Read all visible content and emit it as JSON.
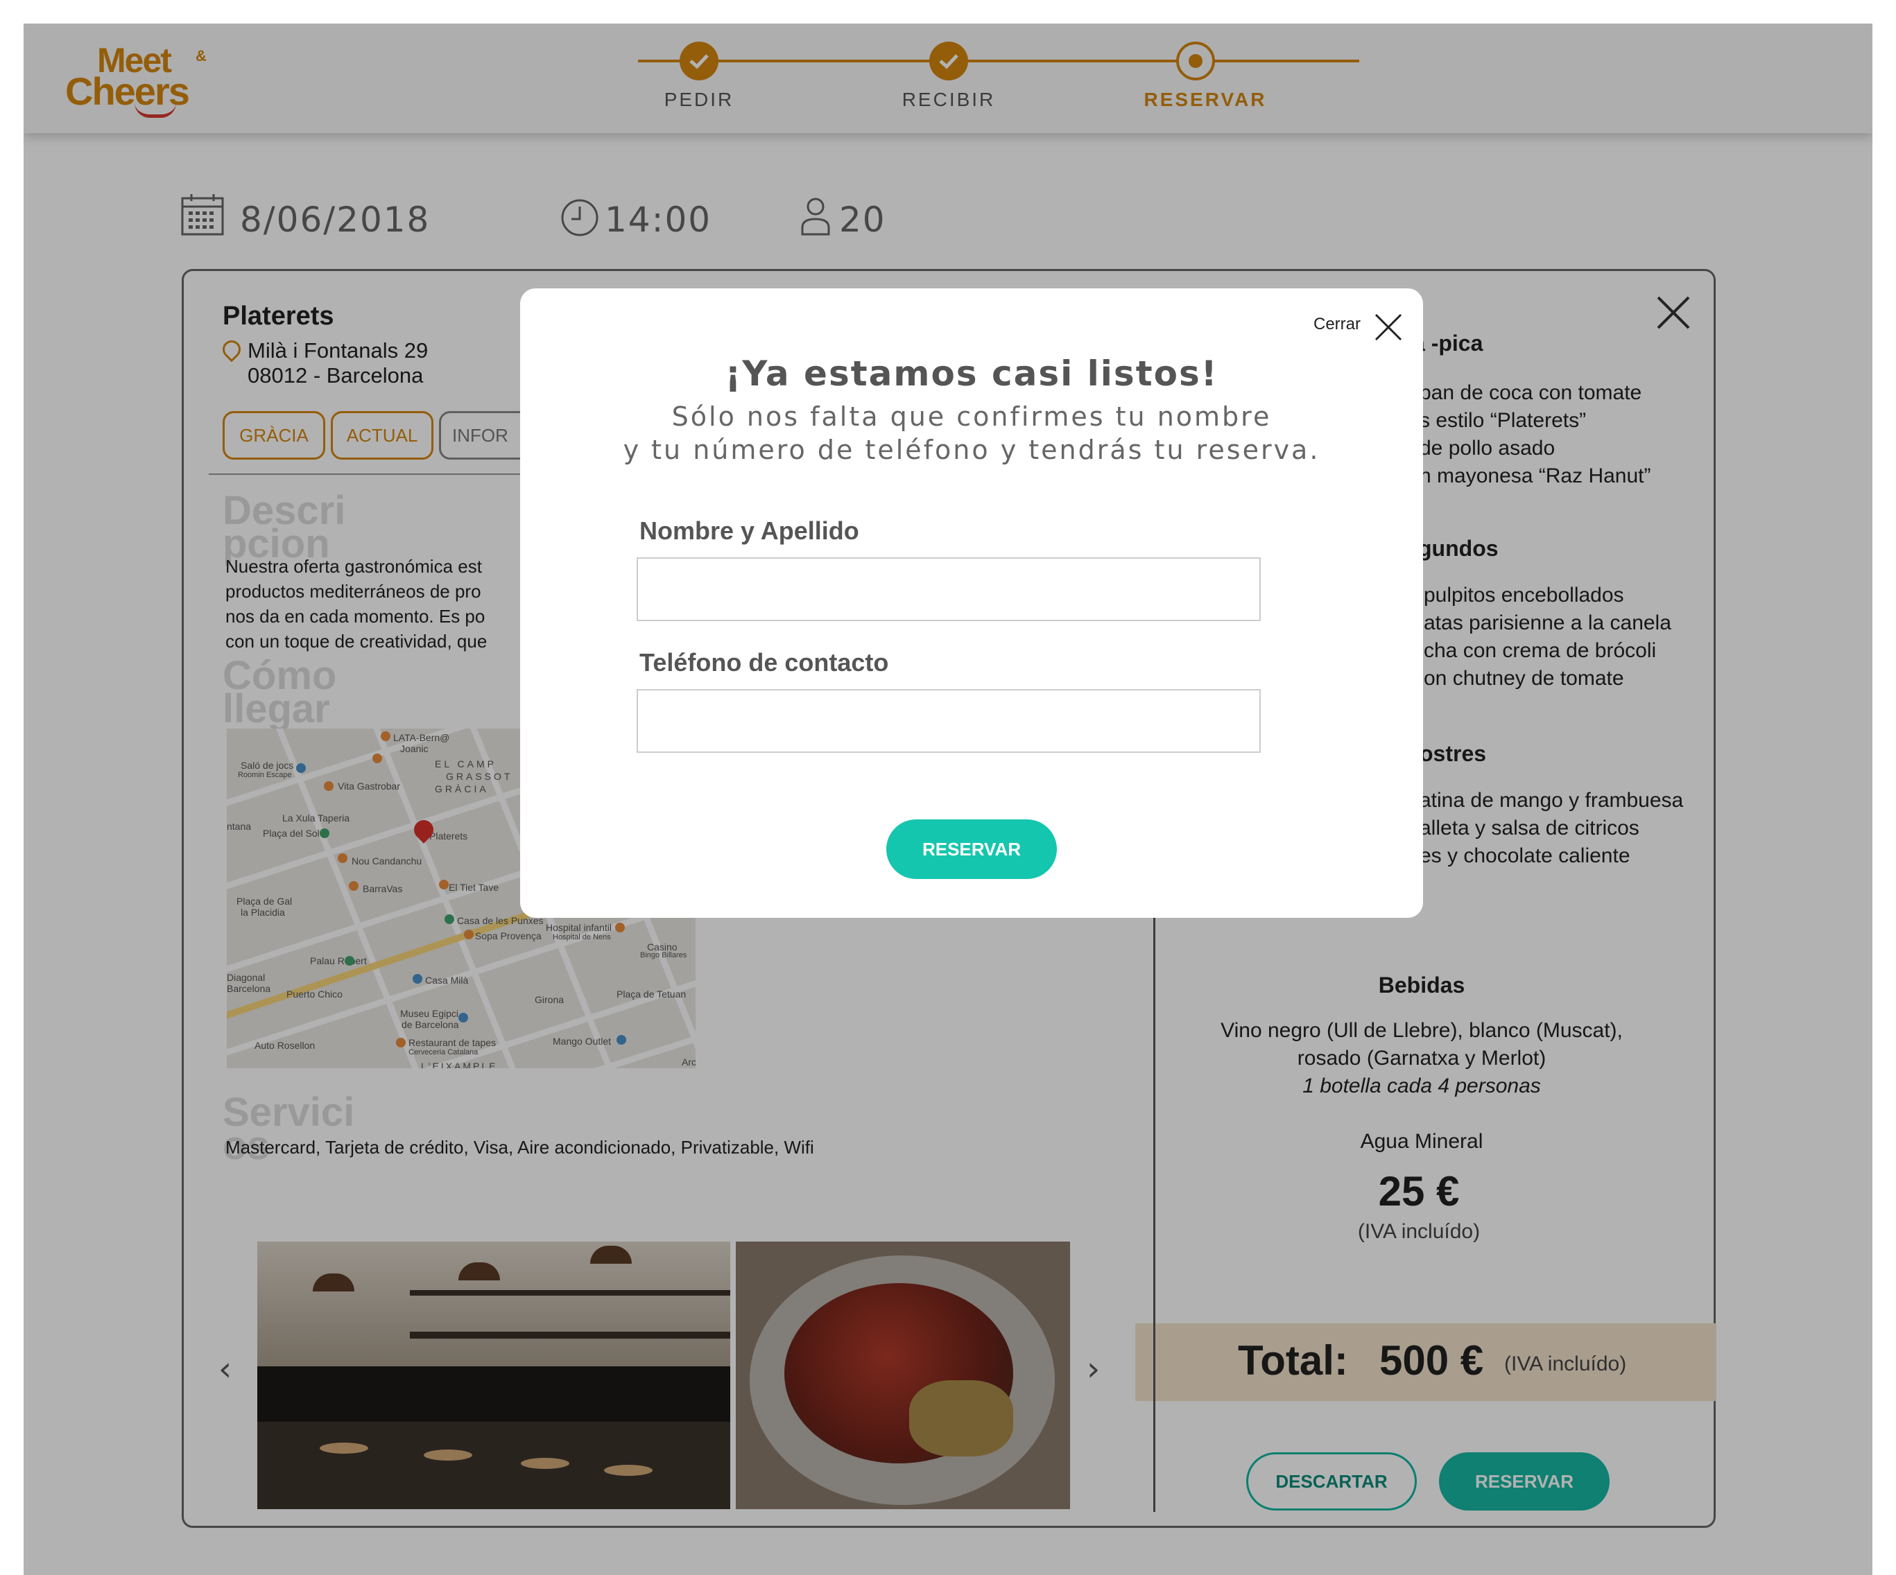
{
  "brand": {
    "line1": "Meet",
    "amp": "&",
    "line2": "Cheers"
  },
  "steps": [
    {
      "label": "PEDIR",
      "state": "done"
    },
    {
      "label": "RECIBIR",
      "state": "done"
    },
    {
      "label": "RESERVAR",
      "state": "current"
    }
  ],
  "summary": {
    "date": "8/06/2018",
    "time": "14:00",
    "guests": "20"
  },
  "restaurant": {
    "name": "Platerets",
    "address_line1": "Milà i Fontanals 29",
    "address_line2": "08012 - Barcelona",
    "tags": [
      "GRÀCIA",
      "ACTUAL",
      "INFOR"
    ]
  },
  "sections": {
    "description_title": "Descri\npcion",
    "description_text": [
      "Nuestra oferta gastronómica est",
      "productos mediterráneos de pro",
      "nos da en cada momento. Es po",
      "con un toque de creatividad, que"
    ],
    "howto_title": "Cómo\nllegar",
    "services_title": "Servici\nos",
    "services_text": "Mastercard, Tarjeta de crédito, Visa, Aire acondicionado, Privatizable, Wifi"
  },
  "map": {
    "labels": [
      "LATA-Bern@",
      "Joanic",
      "Saló de jocs",
      "Roomin Escape",
      "Vita Gastrobar",
      "EL CAMP",
      "GRASSOT",
      "GRÀCIA",
      "La Xula Taperia",
      "Plaça del Sol",
      "Platerets",
      "Nou Candanchu",
      "BarraVas",
      "El Tiet Tave",
      "Plaça de Gal",
      "la Placidia",
      "Casa de les Punxes",
      "Sopa Provença",
      "Hospital infantil",
      "Hospital de Nens",
      "Casino",
      "Bingo Billares",
      "Palau Robert",
      "Diagonal",
      "Barcelona",
      "Puerto Chico",
      "Casa Milà",
      "Plaça de Tetuan",
      "Museu Egipci",
      "de Barcelona",
      "Girona",
      "Auto Rosellon",
      "Restaurant de tapes",
      "Cerveceria Catalana",
      "Mango Outlet",
      "L'EIXAMPLE",
      "ntana",
      "Arc"
    ]
  },
  "menu": {
    "partial_heading1": "a -pica",
    "list1": [
      "pan de coca con tomate",
      "s estilo “Platerets”",
      "de pollo asado",
      "n mayonesa “Raz Hanut”"
    ],
    "partial_heading2": "gundos",
    "list2": [
      "pulpitos encebollados",
      "atas parisienne a la canela",
      "cha con crema de brócoli",
      "on chutney de tomate"
    ],
    "partial_heading3": "ostres",
    "list3": [
      "atina de mango y frambuesa",
      "alleta y salsa de citricos",
      "es y chocolate caliente"
    ],
    "drinks_heading": "Bebidas",
    "drinks_line1": "Vino negro (Ull de Llebre), blanco (Muscat),",
    "drinks_line2": "rosado (Garnatxa y Merlot)",
    "drinks_note": "1 botella cada 4 personas",
    "water": "Agua Mineral",
    "price": "25 €",
    "price_note": "(IVA incluído)"
  },
  "total": {
    "label": "Total:",
    "amount": "500 €",
    "note": "(IVA incluído)"
  },
  "actions": {
    "discard": "DESCARTAR",
    "reserve": "RESERVAR"
  },
  "modal": {
    "close_label": "Cerrar",
    "title": "¡Ya estamos casi listos!",
    "subtitle1": "Sólo nos falta que confirmes tu nombre",
    "subtitle2": "y tu número de teléfono y tendrás tu reserva.",
    "name_label": "Nombre y Apellido",
    "name_value": "",
    "phone_label": "Teléfono de contacto",
    "phone_value": "",
    "submit": "RESERVAR"
  },
  "colors": {
    "accent": "#d4860f",
    "teal": "#16b8a3",
    "total_bg": "#f2e3cc"
  }
}
